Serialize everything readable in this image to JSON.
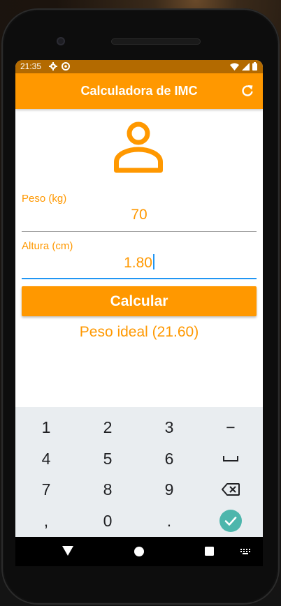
{
  "status_bar": {
    "time": "21:35",
    "left_icons": [
      "gear-icon",
      "sync-icon"
    ],
    "right_icons": [
      "wifi-icon",
      "signal-icon",
      "battery-icon"
    ]
  },
  "app_bar": {
    "title": "Calculadora de IMC",
    "action_icon": "refresh-icon"
  },
  "form": {
    "avatar_icon": "person-icon",
    "weight": {
      "label": "Peso (kg)",
      "value": "70"
    },
    "height": {
      "label": "Altura (cm)",
      "value": "1.80"
    },
    "calculate_label": "Calcular",
    "result": "Peso ideal (21.60)"
  },
  "keyboard": {
    "rows": [
      [
        "1",
        "2",
        "3",
        "−"
      ],
      [
        "4",
        "5",
        "6",
        "␣"
      ],
      [
        "7",
        "8",
        "9",
        "⌫"
      ],
      [
        ",",
        "0",
        ".",
        "✓"
      ]
    ]
  },
  "nav_bar": {
    "items": [
      "back-icon",
      "home-icon",
      "recents-icon",
      "keyboard-icon"
    ]
  },
  "colors": {
    "primary": "#ff9800",
    "status_bar": "#b36a00",
    "accent": "#2196f3",
    "keyboard_bg": "#e9edf0",
    "done_key": "#4db6ac"
  }
}
